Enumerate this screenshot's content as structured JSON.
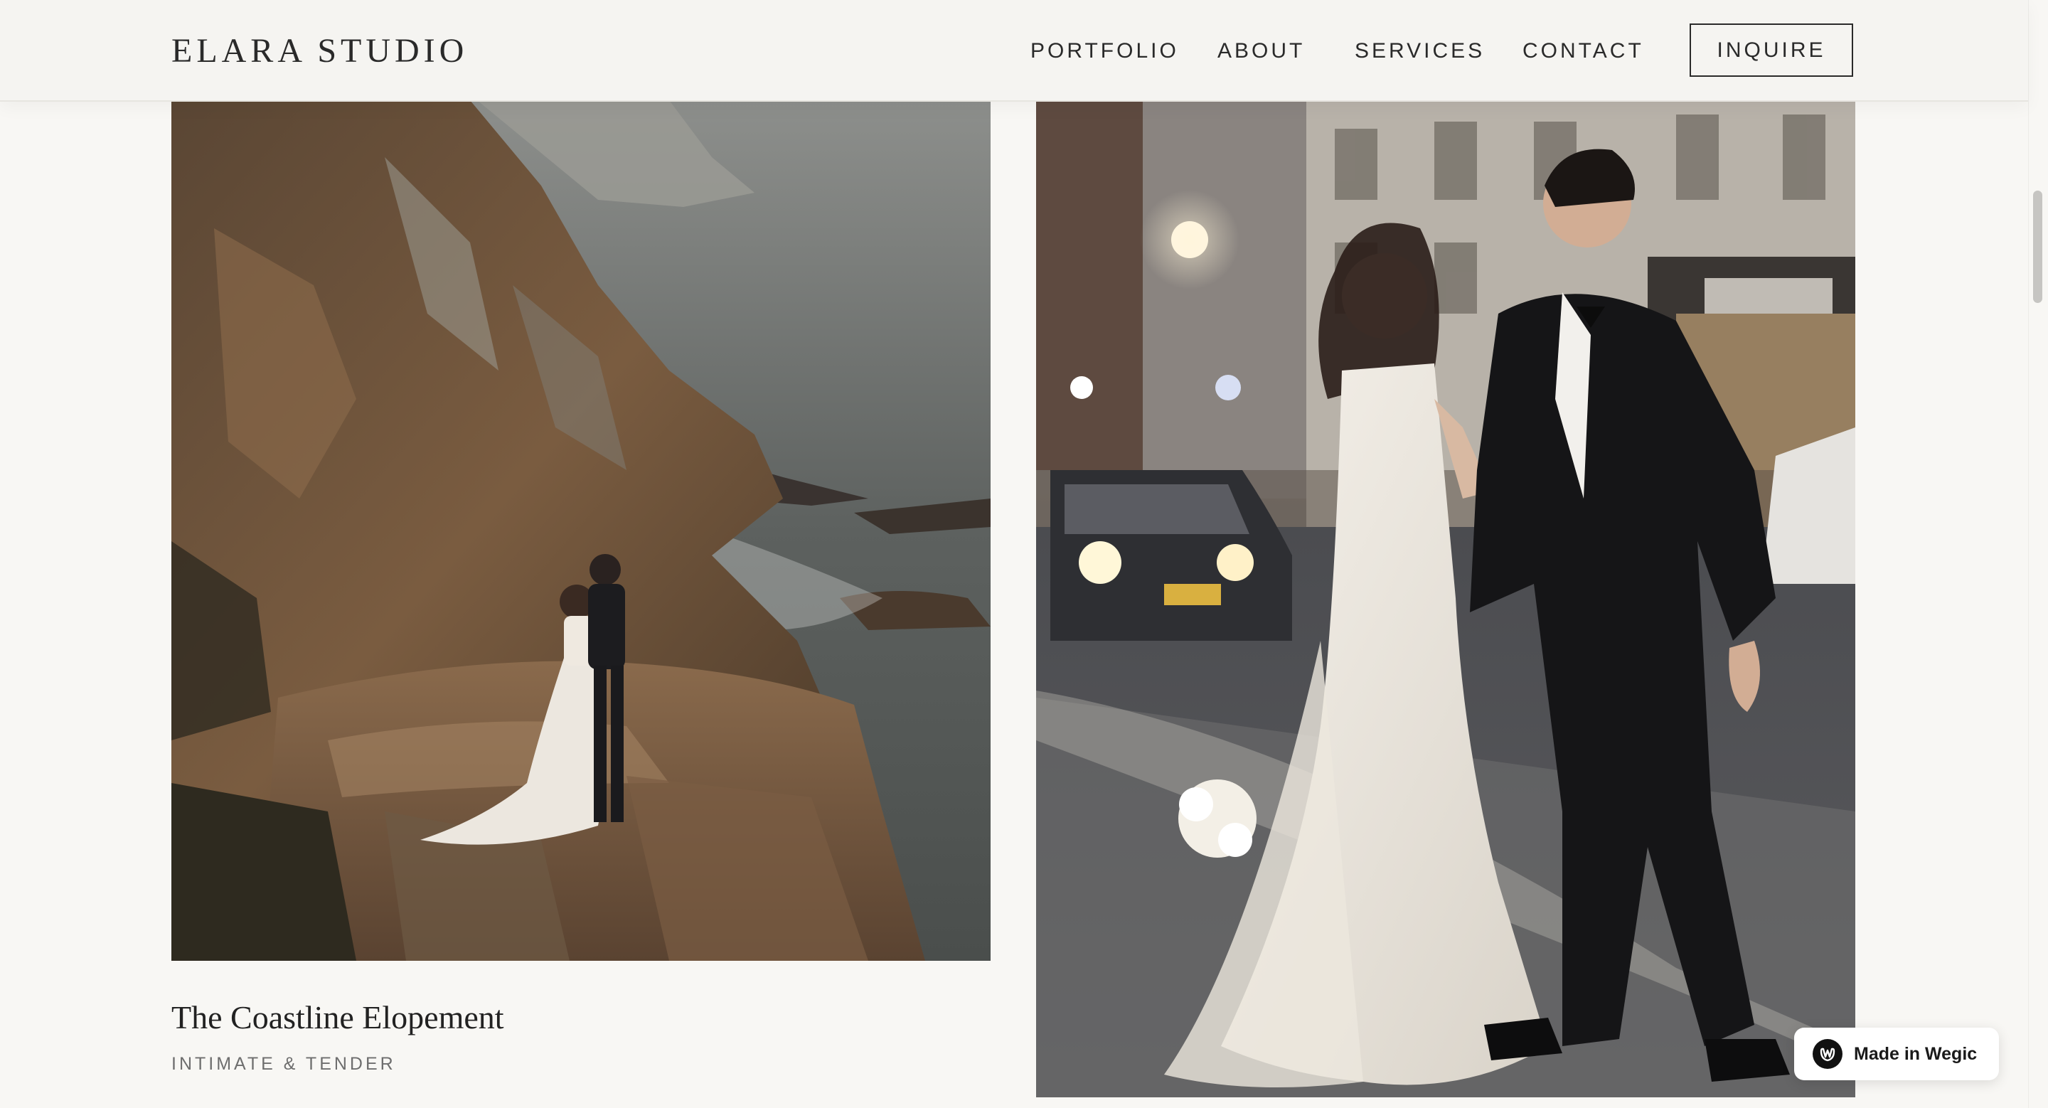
{
  "header": {
    "logo": "ELARA STUDIO",
    "nav": [
      {
        "label": "PORTFOLIO"
      },
      {
        "label": "ABOUT"
      },
      {
        "label": "SERVICES"
      },
      {
        "label": "CONTACT"
      }
    ],
    "cta_label": "INQUIRE"
  },
  "portfolio": {
    "items": [
      {
        "title": "The Coastline Elopement",
        "subtitle": "INTIMATE & TENDER"
      }
    ]
  },
  "badge": {
    "label": "Made in Wegic",
    "icon": "wegic-logo-icon"
  },
  "colors": {
    "background": "#f8f7f4",
    "header": "#f5f4f1",
    "text": "#2a2a2a",
    "muted": "#6e6e6e"
  }
}
